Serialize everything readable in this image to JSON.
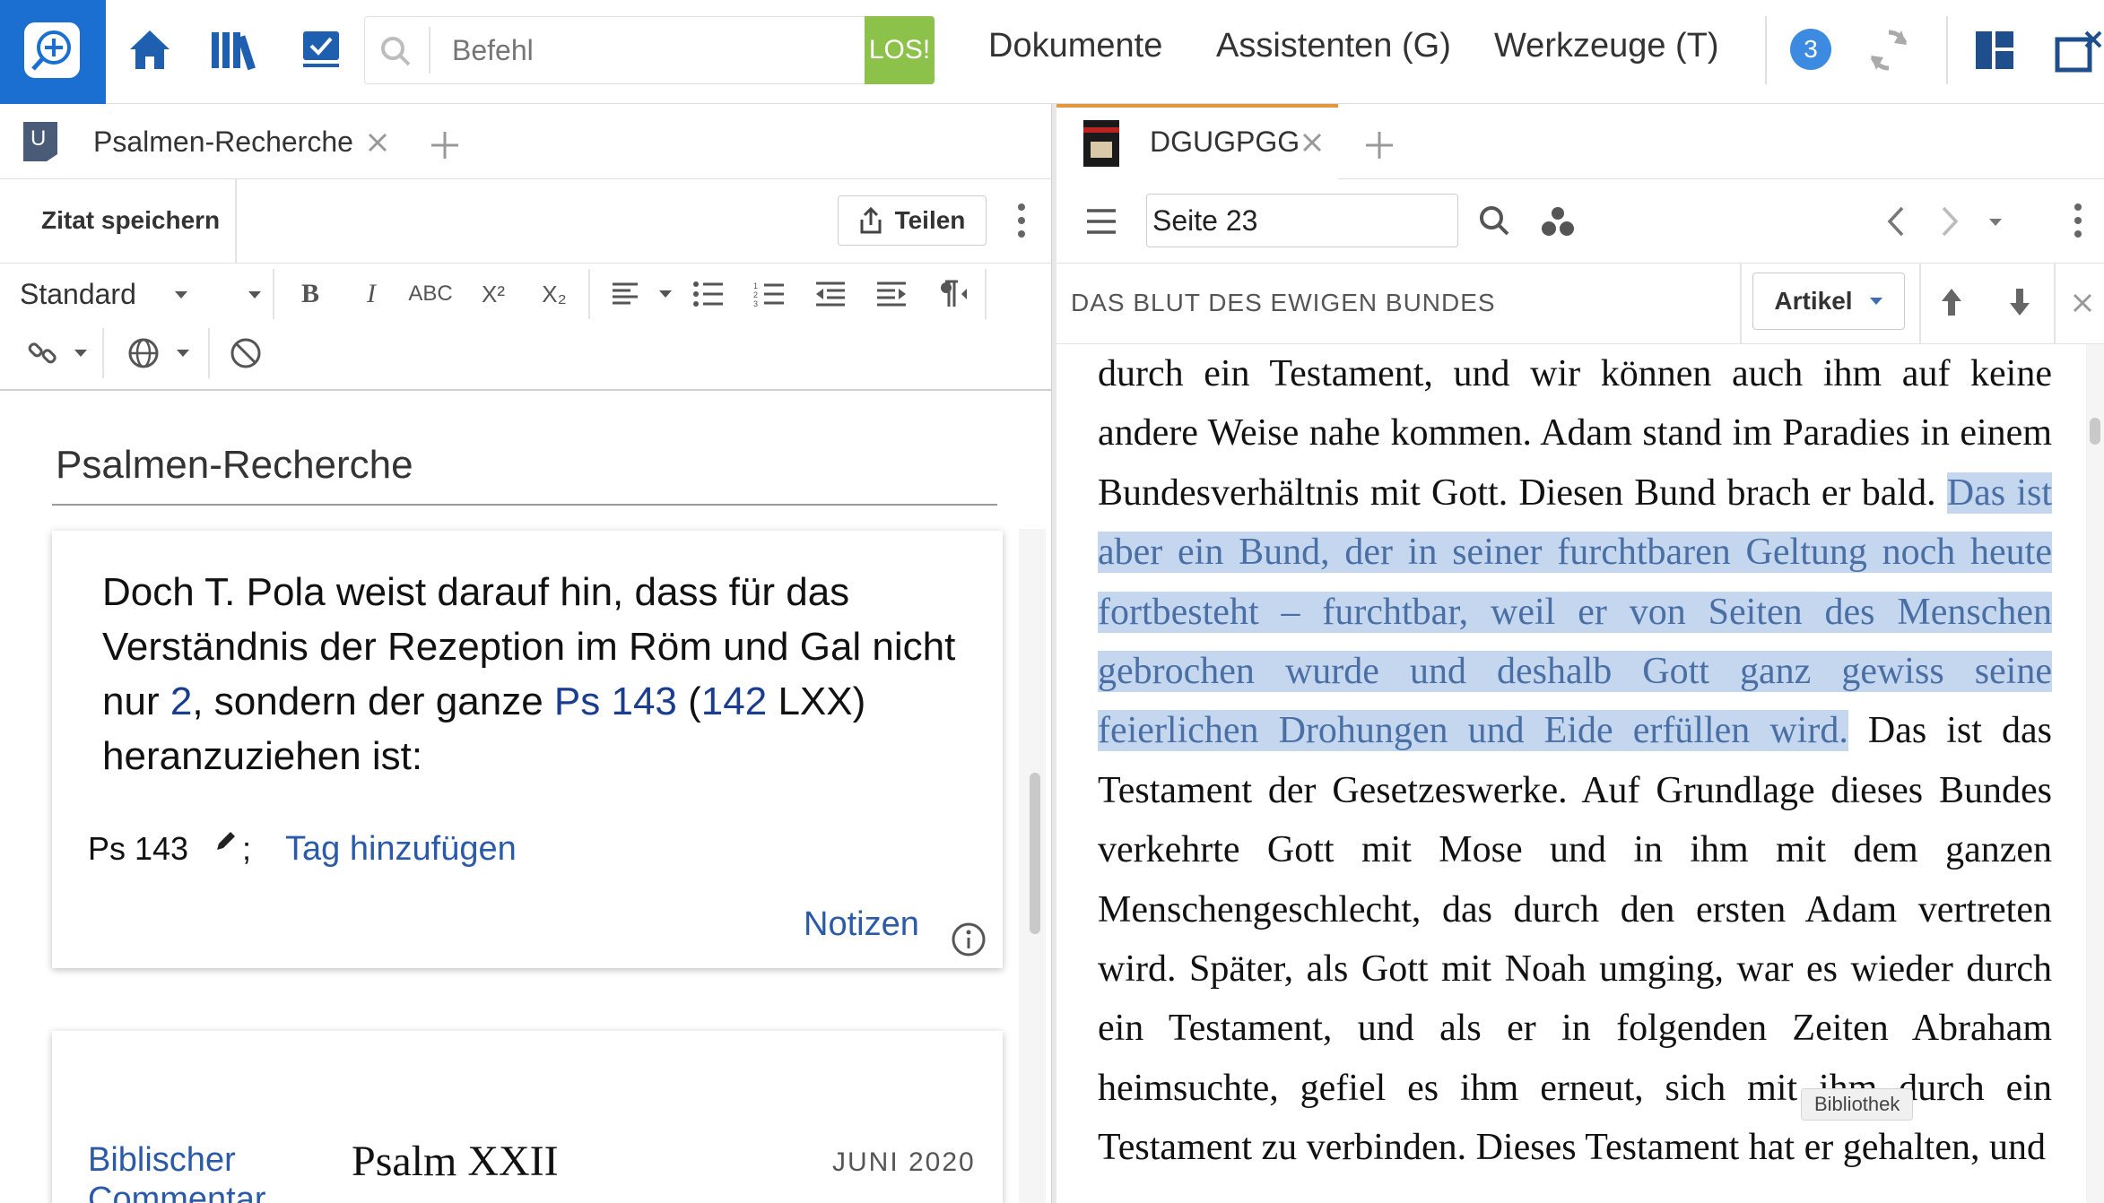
{
  "topbar": {
    "command_placeholder": "Befehl",
    "go_label": "LOS!",
    "menu": [
      "Dokumente",
      "Assistenten (G)",
      "Werkzeuge (T)"
    ],
    "badge_count": "3",
    "accent_color": "#1b6fd1",
    "go_color": "#8cc24a"
  },
  "left": {
    "tab_label": "Psalmen-Recherche",
    "save_quote_label": "Zitat speichern",
    "share_label": "Teilen",
    "style_label": "Standard",
    "format_labels": {
      "strike": "ABC",
      "superscript": "X²",
      "subscript": "X₂"
    },
    "doc_title": "Psalmen-Recherche",
    "card1": {
      "text_part1": "Doch T. Pola weist darauf hin, dass für das Verständnis der Rezeption im Röm und Gal nicht nur ",
      "link1": "2",
      "text_part2": ", sondern der ganze ",
      "link2": "Ps 143",
      "text_part3": " (",
      "link3": "142",
      "text_part4": " LXX) heranzuziehen ist:",
      "ref_label": "Ps 143",
      "ref_sep": ";",
      "add_tag_label": "Tag hinzufügen",
      "notes_label": "Notizen"
    },
    "card2": {
      "source_line1": "Biblischer",
      "source_line2": "Commentar",
      "title": "Psalm XXII",
      "date": "JUNI 2020"
    }
  },
  "right": {
    "tab_label": "DGUGPGG",
    "page_value": "Seite 23",
    "section_title": "DAS BLUT DES EWIGEN BUNDES",
    "article_label": "Artikel",
    "reader": {
      "before": "durch ein Testament, und wir können auch ihm auf keine andere Weise nahe kommen. Adam stand im Paradies in einem Bundesverhältnis mit Gott. Diesen Bund brach er bald. ",
      "highlight": "Das ist aber ein Bund, der in seiner furchtbaren Geltung noch heute fortbesteht – furchtbar, weil er von Seiten des Menschen gebrochen wurde und deshalb Gott ganz gewiss seine feierlichen Drohungen und Eide erfüllen wird.",
      "after": " Das ist das Testament der Gesetzeswerke. Auf Grundlage dieses Bundes verkehrte Gott mit Mose und in ihm mit dem ganzen Menschengeschlecht, das durch den ersten Adam vertreten wird. Später, als Gott mit Noah umging, war es wieder durch ein Testament, und als er in folgenden Zeiten Abraham heimsuchte, gefiel es ihm erneut, sich mit ihm durch ein Testament zu verbinden. Dieses Testament hat er gehalten, und"
    },
    "tooltip": "Bibliothek",
    "highlight_color": "#c5d7ef",
    "tab_accent": "#e39540"
  }
}
